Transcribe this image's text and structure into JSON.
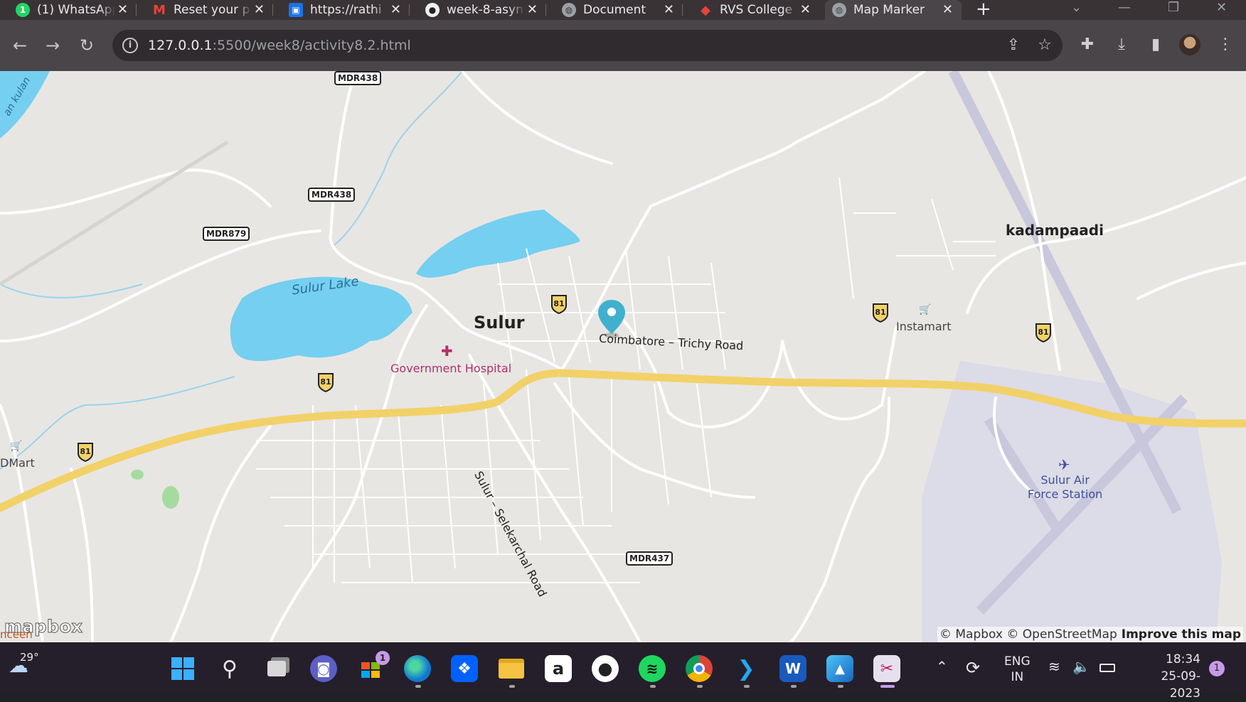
{
  "browser": {
    "tabs": [
      {
        "title": "(1) WhatsApp",
        "icon": "whatsapp-icon",
        "color": "#25d366",
        "glyph": "1"
      },
      {
        "title": "Reset your p",
        "icon": "gmail-icon",
        "color": "#ea4335",
        "glyph": "M"
      },
      {
        "title": "https://rathi",
        "icon": "contacts-icon",
        "color": "#1a73e8",
        "glyph": "▣"
      },
      {
        "title": "week-8-asyn",
        "icon": "github-icon",
        "color": "#f0f0f0",
        "glyph": "●"
      },
      {
        "title": "Document",
        "icon": "globe-icon",
        "color": "#9aa0a6",
        "glyph": "◍"
      },
      {
        "title": "RVS College",
        "icon": "maps-pin-icon",
        "color": "#34a853",
        "glyph": "◆"
      },
      {
        "title": "Map Marker",
        "icon": "globe-icon",
        "color": "#9aa0a6",
        "glyph": "◍",
        "active": true
      }
    ],
    "url_host": "127.0.0.1",
    "url_rest": ":5500/week8/activity8.2.html"
  },
  "map": {
    "places": {
      "sulur": "Sulur",
      "sulur_lake": "Sulur Lake",
      "kadampaadi": "kadampaadi",
      "government_hospital": "Government Hospital",
      "instamart": "Instamart",
      "dmart": "DMart",
      "air_force_line1": "Sulur Air",
      "air_force_line2": "Force Station",
      "river": "an kulan",
      "bottom_left": "nceen"
    },
    "roads": {
      "coimbatore_trichy": "Coimbatore – Trichy Road",
      "sulur_selekarchal": "Sulur – Selekarchal Road"
    },
    "shields": {
      "mdr438": "MDR438",
      "mdr879": "MDR879",
      "mdr437": "MDR437",
      "nh81": "81"
    },
    "attribution": "© Mapbox © OpenStreetMap",
    "improve": "Improve this map",
    "logo": "mapbox",
    "marker_color": "#3fb1ce",
    "road_color": "#f2d168",
    "water_color": "#75cff0"
  },
  "taskbar": {
    "weather_temp": "29°",
    "lang_top": "ENG",
    "lang_bottom": "IN",
    "time": "18:34",
    "date": "25-09-2023",
    "notif_count": "1",
    "store_badge": "1"
  }
}
